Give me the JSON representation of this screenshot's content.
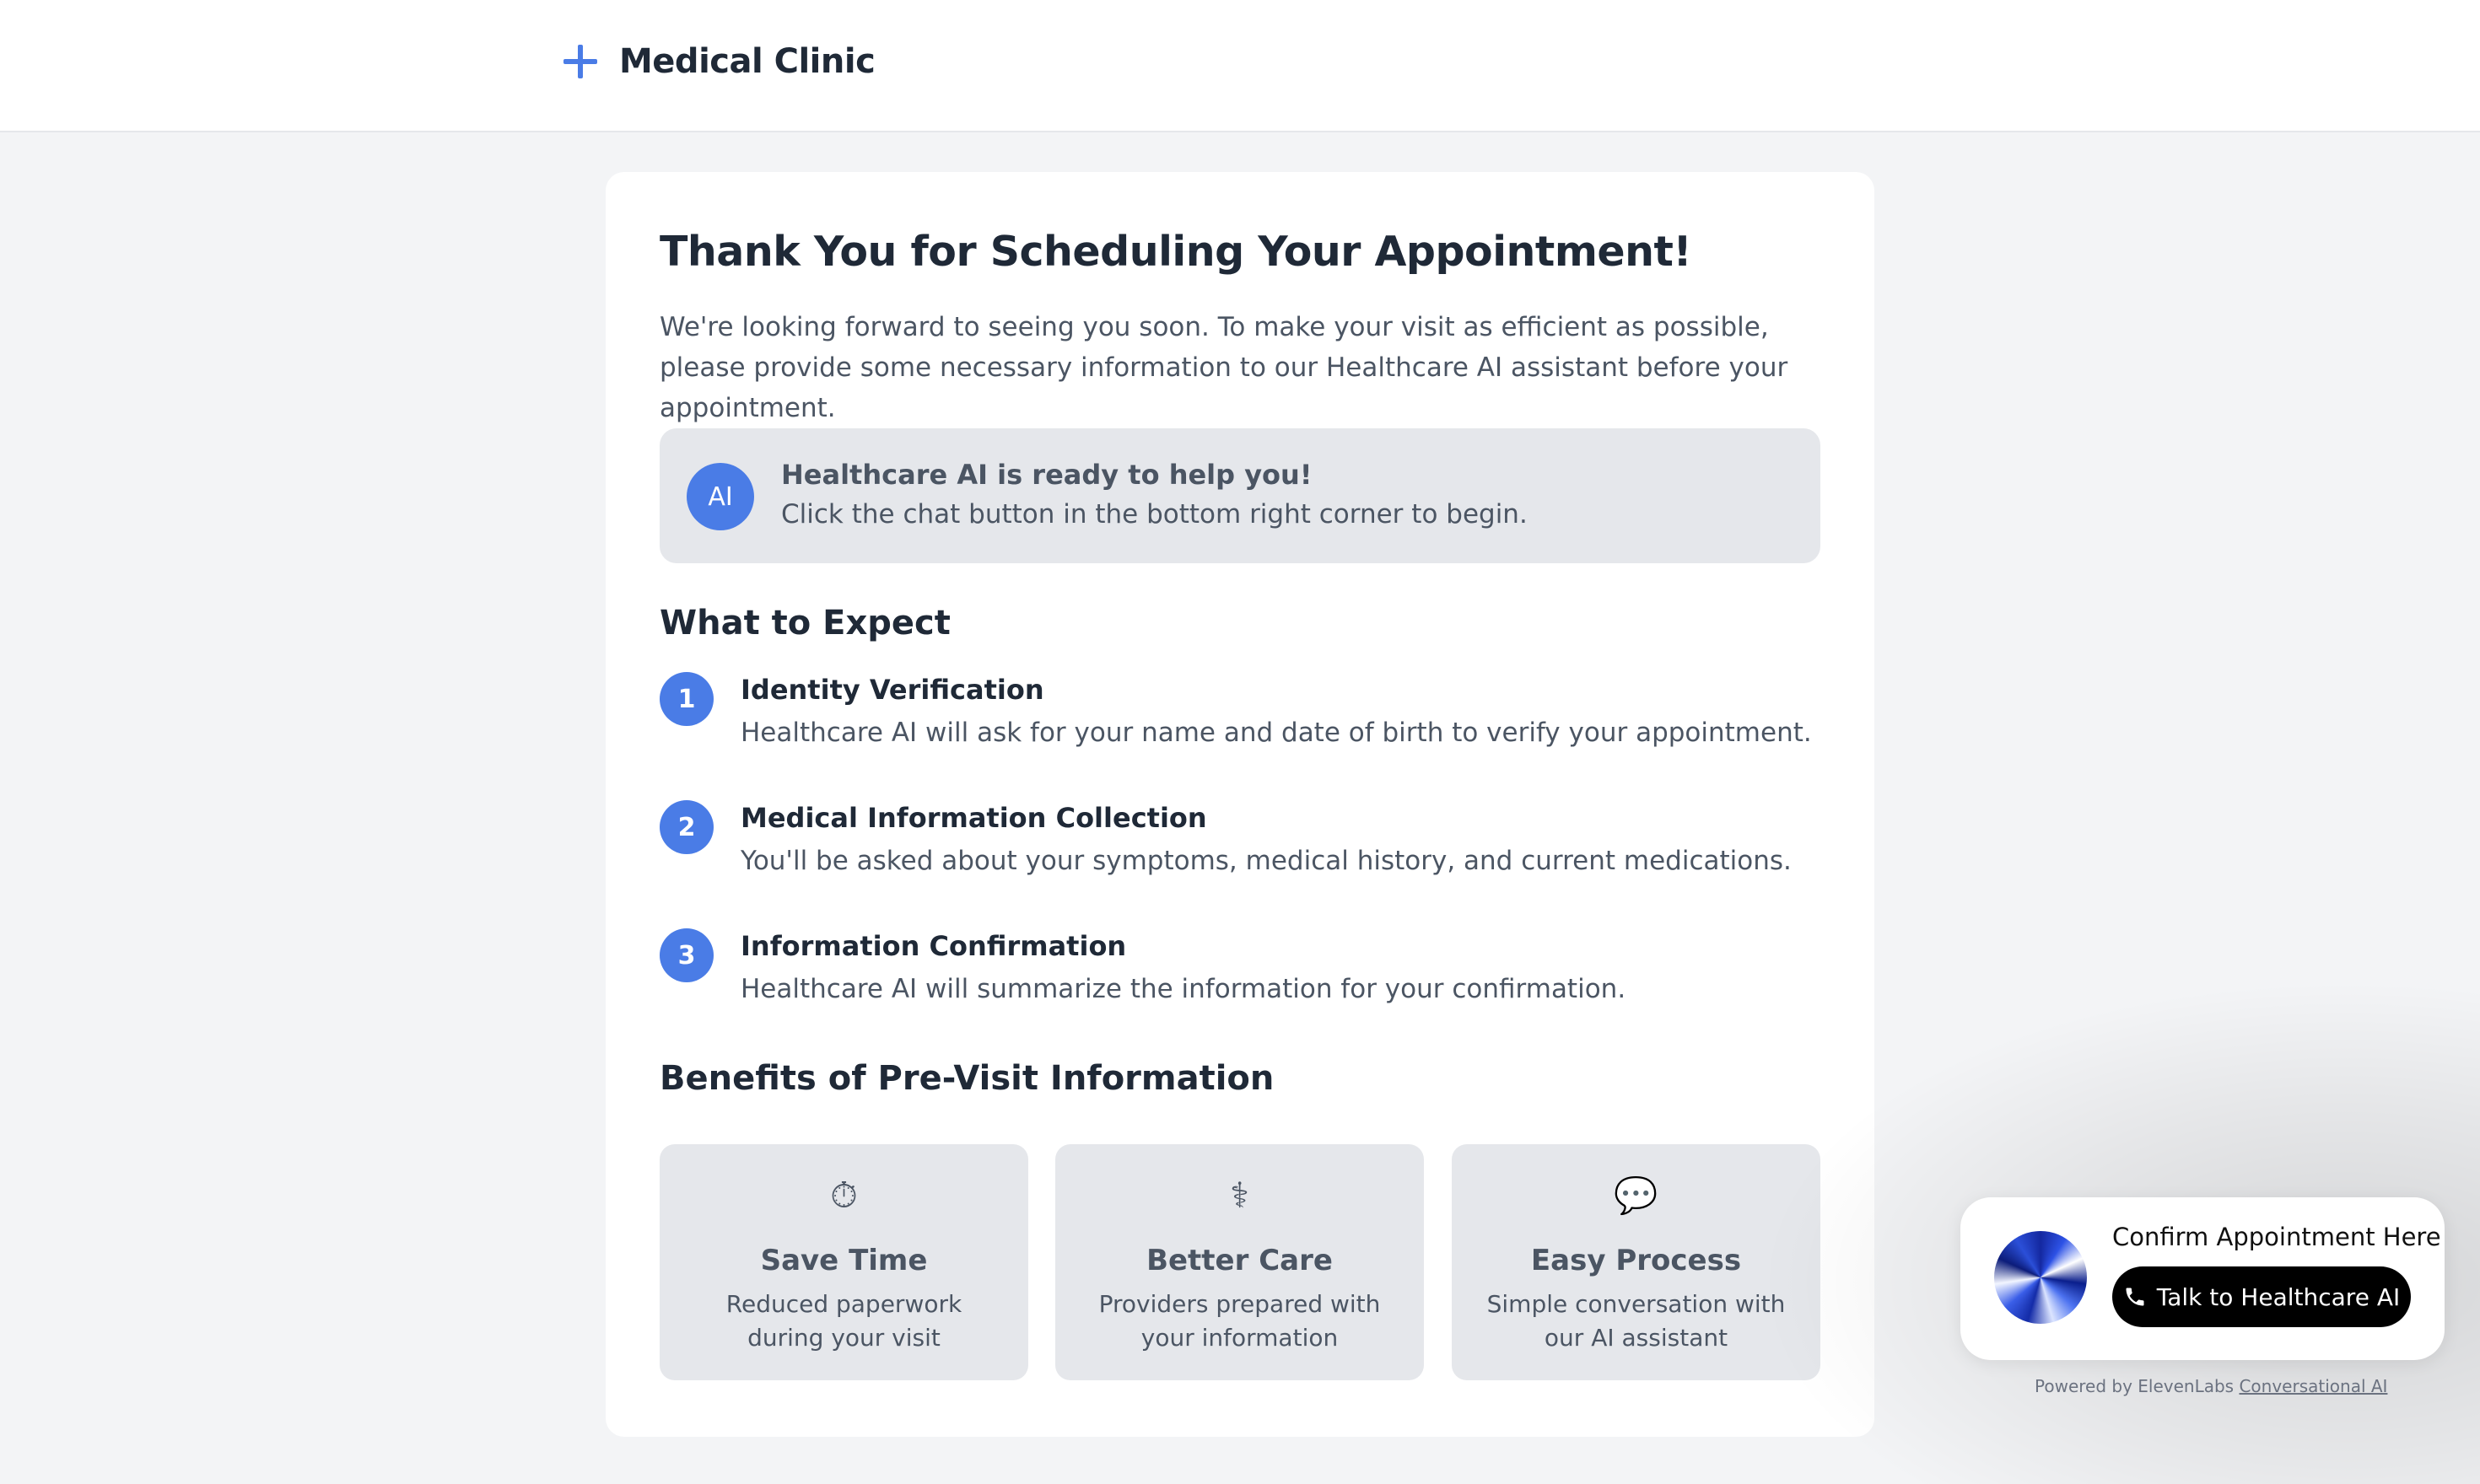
{
  "header": {
    "brand_name": "Medical Clinic",
    "brand_icon": "plus-icon"
  },
  "main": {
    "title": "Thank You for Scheduling Your Appointment!",
    "intro": "We're looking forward to seeing you soon. To make your visit as efficient as possible, please provide some necessary information to our Healthcare AI assistant before your appointment.",
    "ai_notice": {
      "avatar_text": "AI",
      "title": "Healthcare AI is ready to help you!",
      "subtitle": "Click the chat button in the bottom right corner to begin."
    },
    "expect_heading": "What to Expect",
    "steps": [
      {
        "number": "1",
        "title": "Identity Verification",
        "description": "Healthcare AI will ask for your name and date of birth to verify your appointment."
      },
      {
        "number": "2",
        "title": "Medical Information Collection",
        "description": "You'll be asked about your symptoms, medical history, and current medications."
      },
      {
        "number": "3",
        "title": "Information Confirmation",
        "description": "Healthcare AI will summarize the information for your confirmation."
      }
    ],
    "benefits_heading": "Benefits of Pre-Visit Information",
    "benefits": [
      {
        "icon": "stopwatch-icon",
        "glyph": "⏱",
        "title": "Save Time",
        "description": "Reduced paperwork during your visit"
      },
      {
        "icon": "stethoscope-icon",
        "glyph": "⚕",
        "title": "Better Care",
        "description": "Providers prepared with your information"
      },
      {
        "icon": "speech-bubble-icon",
        "glyph": "💬",
        "title": "Easy Process",
        "description": "Simple conversation with our AI assistant"
      }
    ]
  },
  "widget": {
    "title": "Confirm Appointment Here",
    "button_label": "Talk to Healthcare AI",
    "button_icon": "phone-icon",
    "powered_prefix": "Powered by ElevenLabs ",
    "powered_link": "Conversational AI"
  },
  "colors": {
    "accent": "#4a7ce6",
    "page_bg": "#f3f4f6",
    "card_bg": "#ffffff",
    "panel_bg": "#e5e7eb",
    "button_bg": "#000000"
  }
}
